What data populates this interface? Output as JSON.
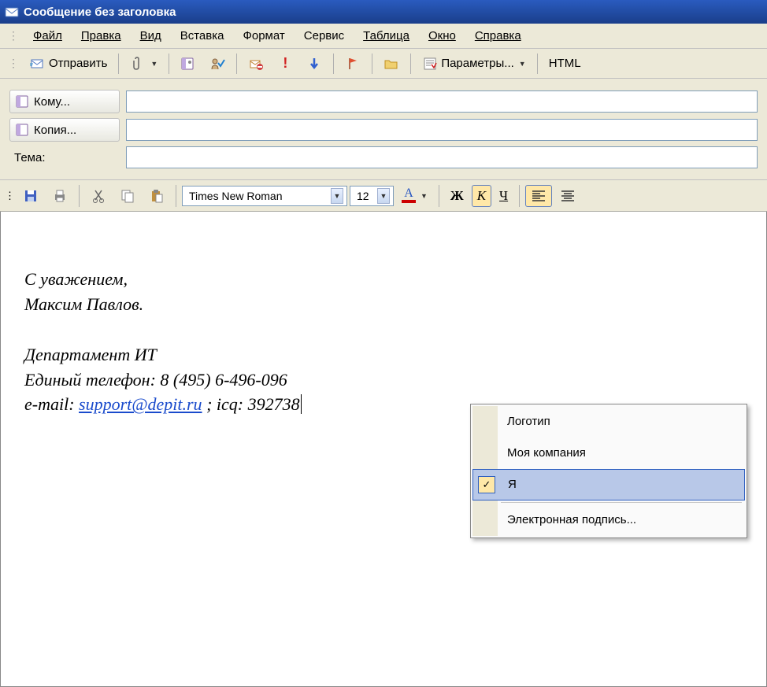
{
  "window": {
    "title": "Сообщение без заголовка"
  },
  "menu": {
    "file": "Файл",
    "edit": "Правка",
    "view": "Вид",
    "insert": "Вставка",
    "format": "Формат",
    "tools": "Сервис",
    "table": "Таблица",
    "window": "Окно",
    "help": "Справка"
  },
  "toolbar1": {
    "send": "Отправить",
    "options": "Параметры...",
    "format_mode": "HTML"
  },
  "fields": {
    "to_label": "Кому...",
    "cc_label": "Копия...",
    "subject_label": "Тема:",
    "to_value": "",
    "cc_value": "",
    "subject_value": ""
  },
  "format_toolbar": {
    "font_name": "Times New Roman",
    "font_size": "12",
    "bold": "Ж",
    "italic": "К",
    "underline": "Ч"
  },
  "body": {
    "line1": "С уважением,",
    "line2": "Максим Павлов.",
    "line3": "Департамент ИТ",
    "line4": "Единый телефон: 8 (495) 6-496-096",
    "line5_pre": "e-mail: ",
    "line5_link": "support@depit.ru",
    "line5_post": " ; icq: 392738"
  },
  "context_menu": {
    "item1": "Логотип",
    "item2": "Моя компания",
    "item3": "Я",
    "item4": "Электронная подпись..."
  },
  "icons": {
    "app": "mail-app-icon",
    "send": "send-mail-icon",
    "attach": "paperclip-icon",
    "addressbook": "addressbook-icon",
    "checknames": "check-names-icon",
    "permission": "permission-icon",
    "importance_high": "importance-high-icon",
    "importance_low": "importance-low-icon",
    "flag": "flag-icon",
    "folder": "folder-icon",
    "options": "options-icon",
    "save": "save-icon",
    "print": "print-icon",
    "cut": "cut-icon",
    "copy": "copy-icon",
    "paste": "paste-icon",
    "font_color": "font-color-icon",
    "align_left": "align-left-icon",
    "align_center": "align-center-icon"
  }
}
